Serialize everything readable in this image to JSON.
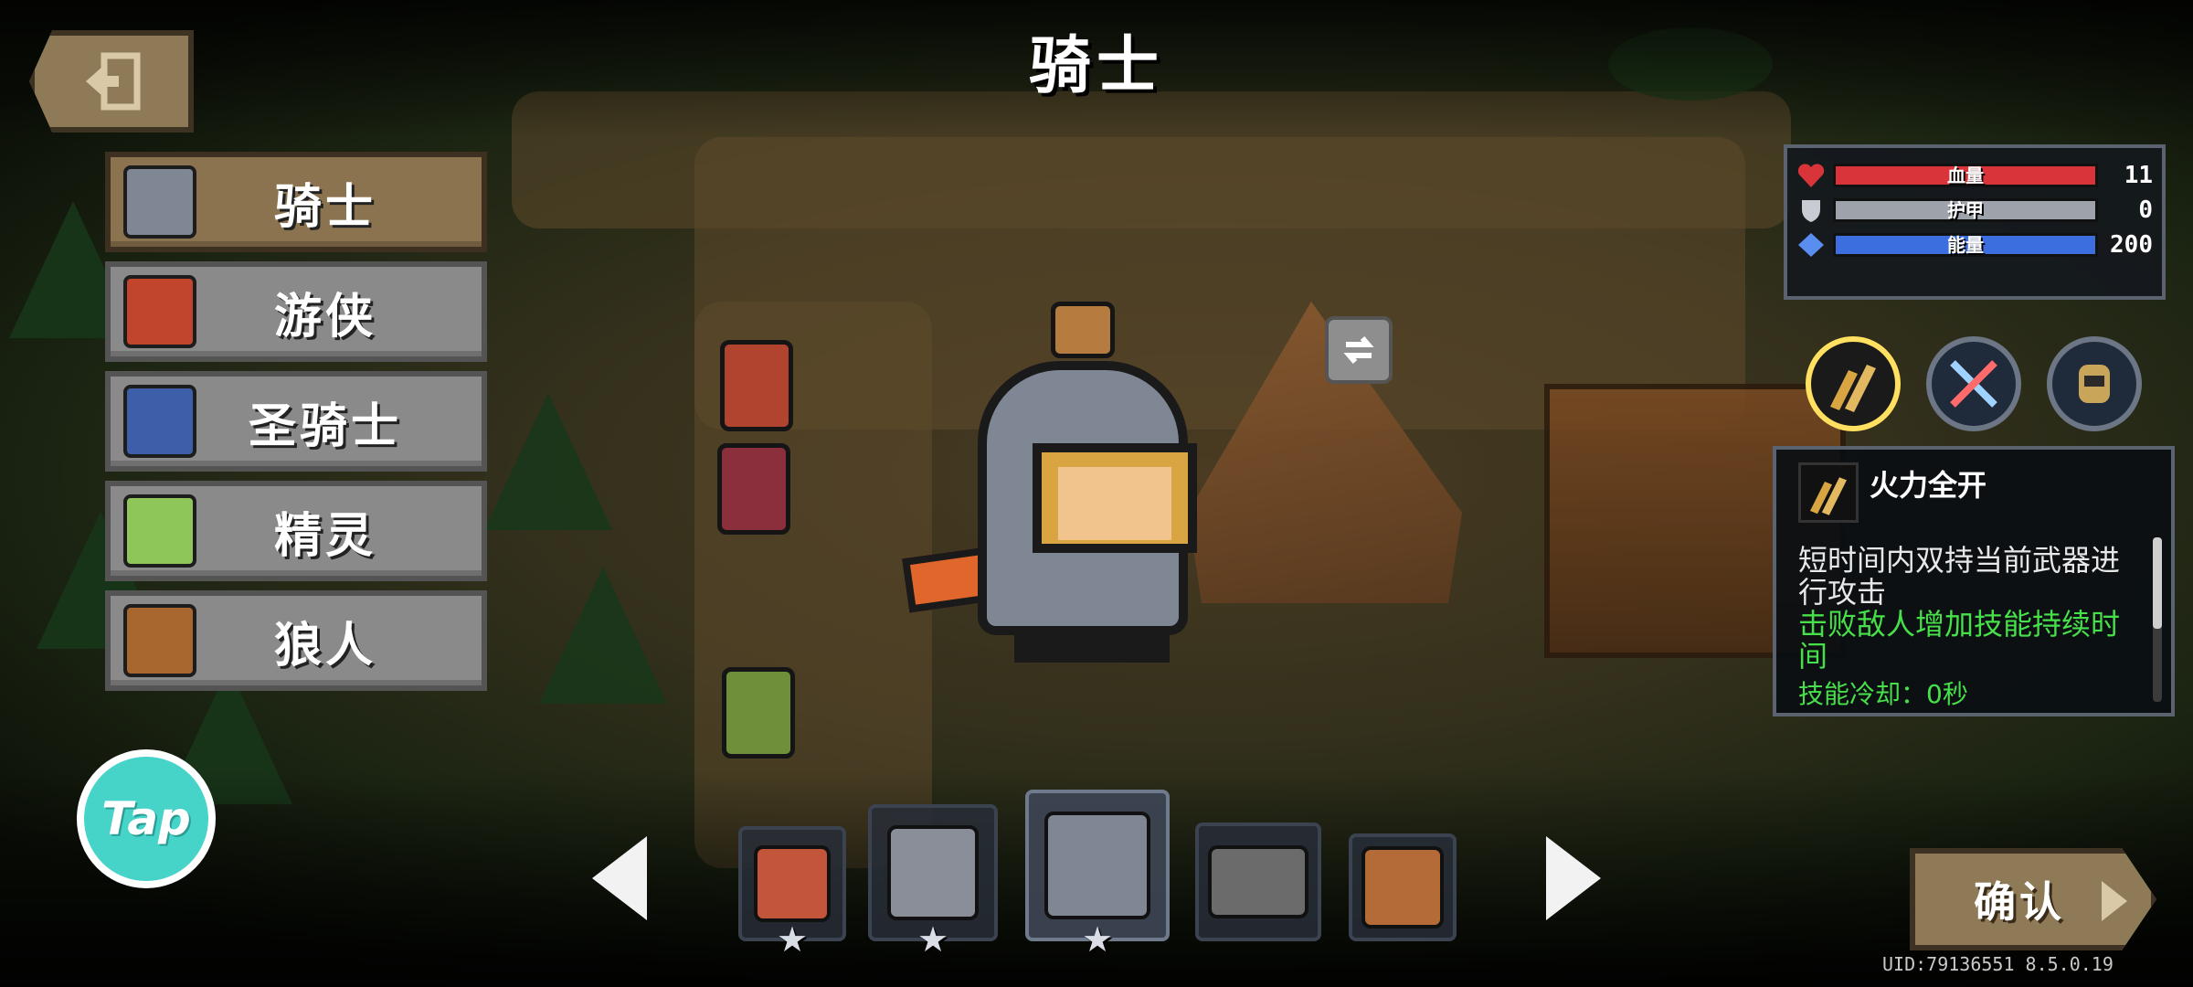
{
  "title": "骑士",
  "classes": [
    {
      "label": "骑士",
      "color": "#7f8694",
      "active": true
    },
    {
      "label": "游侠",
      "color": "#c0452c",
      "active": false
    },
    {
      "label": "圣骑士",
      "color": "#3d5ea8",
      "active": false
    },
    {
      "label": "精灵",
      "color": "#8ec65a",
      "active": false
    },
    {
      "label": "狼人",
      "color": "#a8672e",
      "active": false
    }
  ],
  "tap_badge": "Tap",
  "stats": {
    "hp": {
      "label": "血量",
      "value": "11",
      "color": "#d9343a",
      "icon": "heart-icon"
    },
    "armor": {
      "label": "护甲",
      "value": "0",
      "color": "#9ea3ab",
      "icon": "shield-icon"
    },
    "energy": {
      "label": "能量",
      "value": "200",
      "color": "#3c6ee0",
      "icon": "gem-icon"
    }
  },
  "skills": [
    {
      "name": "dual-guns-skill-icon",
      "selected": true
    },
    {
      "name": "crossed-swords-skill-icon",
      "selected": false
    },
    {
      "name": "knight-bust-skill-icon",
      "selected": false
    }
  ],
  "skill_info": {
    "name": "火力全开",
    "desc": "短时间内双持当前武器进行攻击",
    "bonus": "击败敌人增加技能持续时间",
    "cooldown": "技能冷却：0秒"
  },
  "skins": [
    {
      "name": "horned-skin",
      "color": "#c2553a",
      "selected": false,
      "star": "★"
    },
    {
      "name": "red-plume-skin",
      "color": "#8a8e99",
      "selected": false,
      "star": "★"
    },
    {
      "name": "default-knight-skin",
      "color": "#7f8694",
      "selected": true,
      "star": "★"
    },
    {
      "name": "gun-skin",
      "color": "#6b6b6b",
      "selected": false,
      "star": ""
    },
    {
      "name": "beast-skin",
      "color": "#b56b38",
      "selected": false,
      "star": ""
    }
  ],
  "confirm_label": "确认",
  "uid_text": "UID:79136551 8.5.0.19"
}
